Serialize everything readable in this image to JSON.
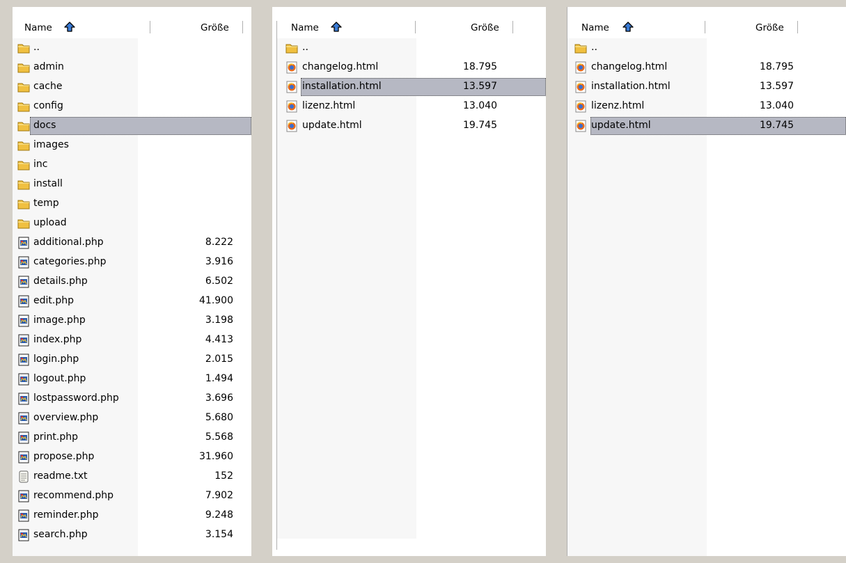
{
  "colors": {
    "selection": "#b6b8c3",
    "folder": "#f0c040",
    "accent": "#3a7bd5"
  },
  "panes": [
    {
      "header": {
        "name": "Name",
        "size": "Größe"
      },
      "rows": [
        {
          "name": "..",
          "size": "",
          "icon": "folder-icon"
        },
        {
          "name": "admin",
          "size": "",
          "icon": "folder-icon"
        },
        {
          "name": "cache",
          "size": "",
          "icon": "folder-icon"
        },
        {
          "name": "config",
          "size": "",
          "icon": "folder-icon"
        },
        {
          "name": "docs",
          "size": "",
          "icon": "folder-icon",
          "selected": true
        },
        {
          "name": "images",
          "size": "",
          "icon": "folder-icon"
        },
        {
          "name": "inc",
          "size": "",
          "icon": "folder-icon"
        },
        {
          "name": "install",
          "size": "",
          "icon": "folder-icon"
        },
        {
          "name": "temp",
          "size": "",
          "icon": "folder-icon"
        },
        {
          "name": "upload",
          "size": "",
          "icon": "folder-icon"
        },
        {
          "name": "additional.php",
          "size": "8.222",
          "icon": "php-file-icon"
        },
        {
          "name": "categories.php",
          "size": "3.916",
          "icon": "php-file-icon"
        },
        {
          "name": "details.php",
          "size": "6.502",
          "icon": "php-file-icon"
        },
        {
          "name": "edit.php",
          "size": "41.900",
          "icon": "php-file-icon"
        },
        {
          "name": "image.php",
          "size": "3.198",
          "icon": "php-file-icon"
        },
        {
          "name": "index.php",
          "size": "4.413",
          "icon": "php-file-icon"
        },
        {
          "name": "login.php",
          "size": "2.015",
          "icon": "php-file-icon"
        },
        {
          "name": "logout.php",
          "size": "1.494",
          "icon": "php-file-icon"
        },
        {
          "name": "lostpassword.php",
          "size": "3.696",
          "icon": "php-file-icon"
        },
        {
          "name": "overview.php",
          "size": "5.680",
          "icon": "php-file-icon"
        },
        {
          "name": "print.php",
          "size": "5.568",
          "icon": "php-file-icon"
        },
        {
          "name": "propose.php",
          "size": "31.960",
          "icon": "php-file-icon"
        },
        {
          "name": "readme.txt",
          "size": "152",
          "icon": "text-file-icon"
        },
        {
          "name": "recommend.php",
          "size": "7.902",
          "icon": "php-file-icon"
        },
        {
          "name": "reminder.php",
          "size": "9.248",
          "icon": "php-file-icon"
        },
        {
          "name": "search.php",
          "size": "3.154",
          "icon": "php-file-icon"
        }
      ]
    },
    {
      "header": {
        "name": "Name",
        "size": "Größe"
      },
      "rows": [
        {
          "name": "..",
          "size": "",
          "icon": "folder-icon"
        },
        {
          "name": "changelog.html",
          "size": "18.795",
          "icon": "firefox-html-icon"
        },
        {
          "name": "installation.html",
          "size": "13.597",
          "icon": "firefox-html-icon",
          "selected": true
        },
        {
          "name": "lizenz.html",
          "size": "13.040",
          "icon": "firefox-html-icon"
        },
        {
          "name": "update.html",
          "size": "19.745",
          "icon": "firefox-html-icon"
        }
      ]
    },
    {
      "header": {
        "name": "Name",
        "size": "Größe"
      },
      "rows": [
        {
          "name": "..",
          "size": "",
          "icon": "folder-icon"
        },
        {
          "name": "changelog.html",
          "size": "18.795",
          "icon": "firefox-html-icon"
        },
        {
          "name": "installation.html",
          "size": "13.597",
          "icon": "firefox-html-icon"
        },
        {
          "name": "lizenz.html",
          "size": "13.040",
          "icon": "firefox-html-icon"
        },
        {
          "name": "update.html",
          "size": "19.745",
          "icon": "firefox-html-icon",
          "selected": true
        }
      ]
    }
  ]
}
